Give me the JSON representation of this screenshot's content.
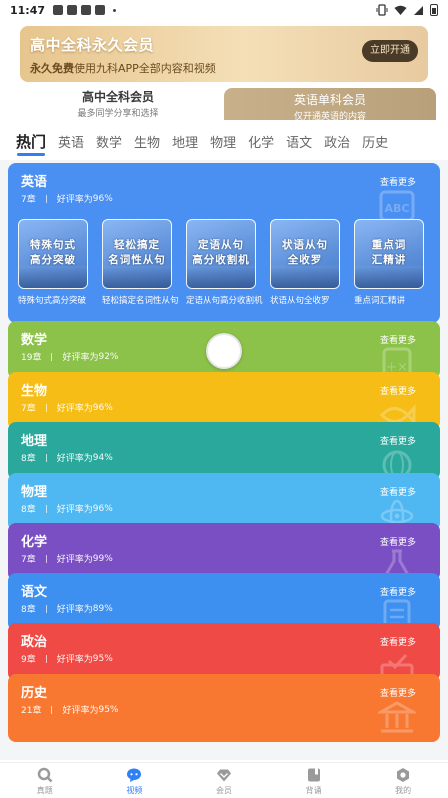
{
  "status_bar": {
    "time": "11:47"
  },
  "banner": {
    "title": "高中全科永久会员",
    "subtitle_bold": "永久免费",
    "subtitle_rest": "使用九科APP全部内容和视频",
    "button": "立即开通"
  },
  "member_tabs": [
    {
      "title": "高中全科会员",
      "desc": "最多同学分享和选择"
    },
    {
      "title": "英语单科会员",
      "desc": "仅开通英语的内容"
    }
  ],
  "subject_tabs": [
    "热门",
    "英语",
    "数学",
    "生物",
    "地理",
    "物理",
    "化学",
    "语文",
    "政治",
    "历史"
  ],
  "active_subject": "热门",
  "rating_prefix": "好评率为",
  "more_label": "查看更多",
  "cards": [
    {
      "name": "英语",
      "chapters": "7章",
      "rating": "96%",
      "color": "#4a8ff2"
    },
    {
      "name": "数学",
      "chapters": "19章",
      "rating": "92%",
      "color": "#8cc24a"
    },
    {
      "name": "生物",
      "chapters": "7章",
      "rating": "96%",
      "color": "#f5bd16"
    },
    {
      "name": "地理",
      "chapters": "8章",
      "rating": "94%",
      "color": "#2aa89b"
    },
    {
      "name": "物理",
      "chapters": "8章",
      "rating": "96%",
      "color": "#4fb8f2"
    },
    {
      "name": "化学",
      "chapters": "7章",
      "rating": "99%",
      "color": "#7a4fc3"
    },
    {
      "name": "语文",
      "chapters": "8章",
      "rating": "89%",
      "color": "#3d8ff0"
    },
    {
      "name": "政治",
      "chapters": "9章",
      "rating": "95%",
      "color": "#ef4a45"
    },
    {
      "name": "历史",
      "chapters": "21章",
      "rating": "95%",
      "color": "#f87832"
    }
  ],
  "english_videos": [
    {
      "thumb": "特殊句式\n高分突破",
      "title": "特殊句式高分突破"
    },
    {
      "thumb": "轻松搞定\n名词性从句",
      "title": "轻松搞定名词性从句"
    },
    {
      "thumb": "定语从句\n高分收割机",
      "title": "定语从句高分收割机"
    },
    {
      "thumb": "状语从句\n全收罗",
      "title": "状语从句全收罗"
    },
    {
      "thumb": "重点词\n汇精讲",
      "title": "重点词汇精讲"
    }
  ],
  "bottom_nav": [
    {
      "label": "真题",
      "icon": "search-icon"
    },
    {
      "label": "视频",
      "icon": "chat-bubble-icon"
    },
    {
      "label": "会员",
      "icon": "diamond-icon"
    },
    {
      "label": "背诵",
      "icon": "book-icon"
    },
    {
      "label": "我的",
      "icon": "profile-icon"
    }
  ],
  "active_nav": "视频",
  "colors": {
    "accent": "#2f7ff6",
    "banner_gold": "#e7c58e"
  }
}
